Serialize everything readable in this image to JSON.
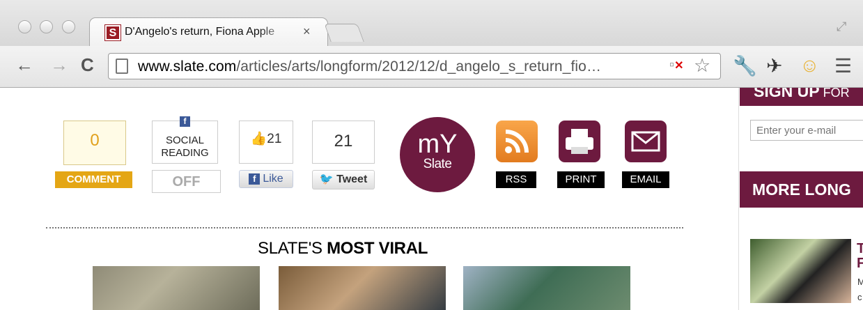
{
  "browser": {
    "tab_title": "D'Angelo's return, Fiona Apple",
    "favicon_letter": "S",
    "close_symbol": "×",
    "url_domain": "www.slate.com",
    "url_rest": "/articles/arts/longform/2012/12/d_angelo_s_return_fio…",
    "back_glyph": "←",
    "forward_glyph": "→",
    "reload_glyph": "C",
    "restore_glyph": "⤢"
  },
  "share": {
    "comment_count": "0",
    "comment_label": "COMMENT",
    "social_label_1": "SOCIAL",
    "social_label_2": "READING",
    "social_state": "OFF",
    "facebook_letter": "f",
    "like_count": "21",
    "like_label": "Like",
    "tweet_count": "21",
    "tweet_label": "Tweet",
    "myslate_top": "mY",
    "myslate_bottom": "Slate",
    "rss_label": "RSS",
    "print_label": "PRINT",
    "email_label": "EMAIL"
  },
  "viral": {
    "prefix": "SLATE'S ",
    "bold": "MOST VIRAL"
  },
  "sidebar": {
    "signup_bold": "SIGN UP",
    "signup_rest": " FOR",
    "email_placeholder": "Enter your e-mail",
    "more_prefix": "MORE ",
    "more_bold": "LONG",
    "article_title_1": "T",
    "article_title_2": "F",
    "article_snippet_1": "M",
    "article_snippet_2": "c"
  },
  "colors": {
    "slate_maroon": "#6d1a3f",
    "comment_gold": "#e4a615",
    "rss_orange": "#f08a24",
    "facebook_blue": "#3b5998"
  },
  "icons": [
    "page-icon",
    "blocked-popup-icon",
    "bookmark-star-icon",
    "wrench-icon",
    "pin-icon",
    "face-extension-icon",
    "menu-notice-icon",
    "rss-icon",
    "printer-icon",
    "envelope-icon",
    "thumbs-up-icon",
    "twitter-bird-icon"
  ]
}
